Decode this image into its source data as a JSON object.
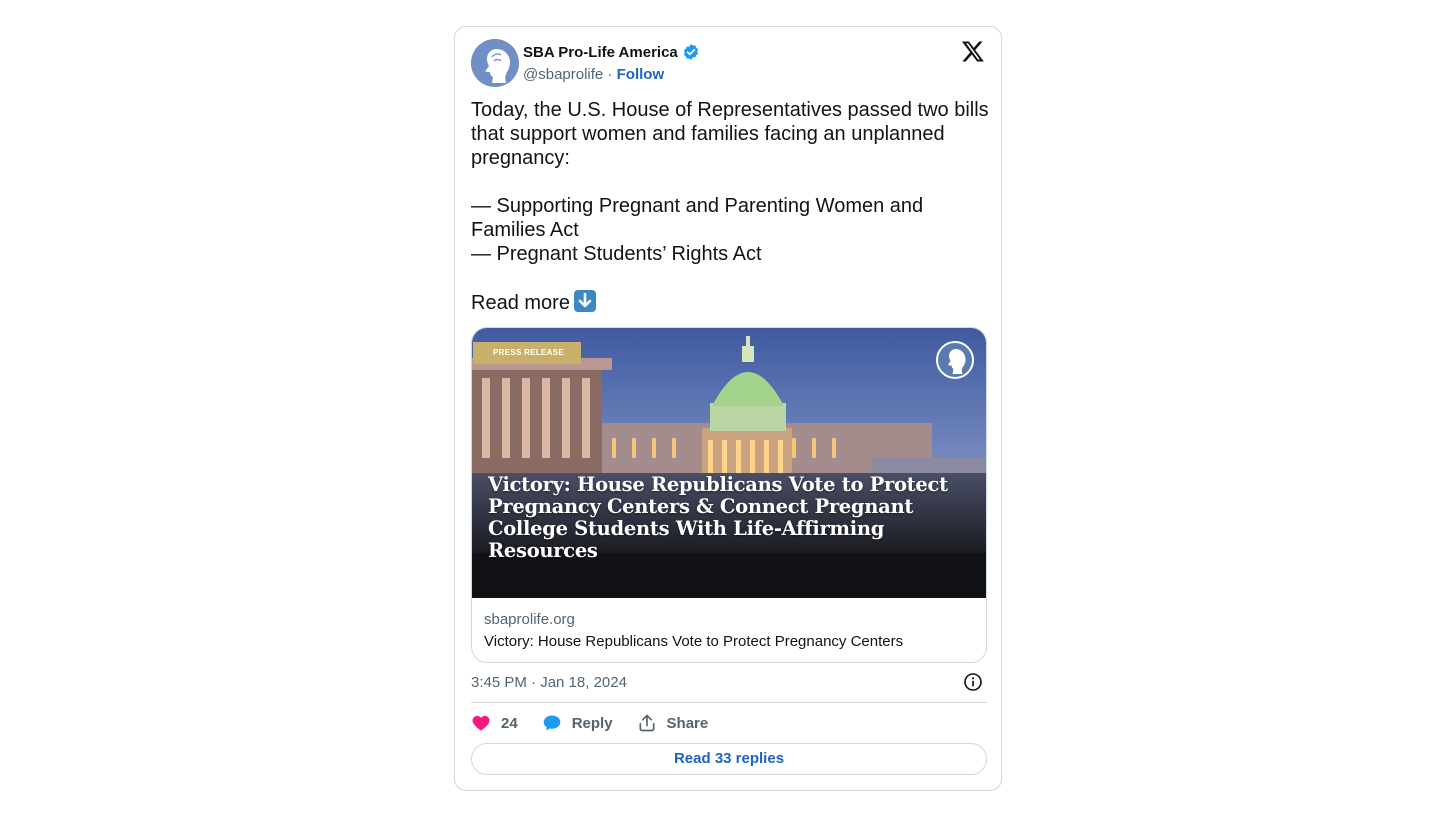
{
  "author": {
    "name": "SBA Pro-Life America",
    "handle": "@sbaprolife",
    "separator": "·",
    "follow_label": "Follow"
  },
  "tweet": {
    "text": "Today, the U.S. House of Representatives passed two bills that support women and families facing an unplanned pregnancy:\n\n— Supporting Pregnant and Parenting Women and Families Act\n— Pregnant Students’ Rights Act\n\nRead more"
  },
  "link_card": {
    "badge": "PRESS RELEASE",
    "image_headline": "Victory: House Republicans Vote to Protect Pregnancy Centers & Connect Pregnant College Students With Life-Affirming Resources",
    "domain": "sbaprolife.org",
    "title": "Victory: House Republicans Vote to Protect Pregnancy Centers"
  },
  "meta": {
    "timestamp": "3:45 PM · Jan 18, 2024"
  },
  "actions": {
    "like_count": "24",
    "reply_label": "Reply",
    "share_label": "Share"
  },
  "footer": {
    "read_replies_label": "Read 33 replies"
  },
  "colors": {
    "accent": "#1d64c4",
    "verified": "#1d9bf0",
    "like": "#f91880",
    "reply": "#1d9bf0",
    "border": "#cfd9de",
    "secondary_text": "#536471"
  },
  "icons": [
    "verified-badge-icon",
    "x-logo-icon",
    "arrow-down-emoji-icon",
    "info-icon",
    "heart-icon",
    "reply-bubble-icon",
    "share-icon"
  ]
}
